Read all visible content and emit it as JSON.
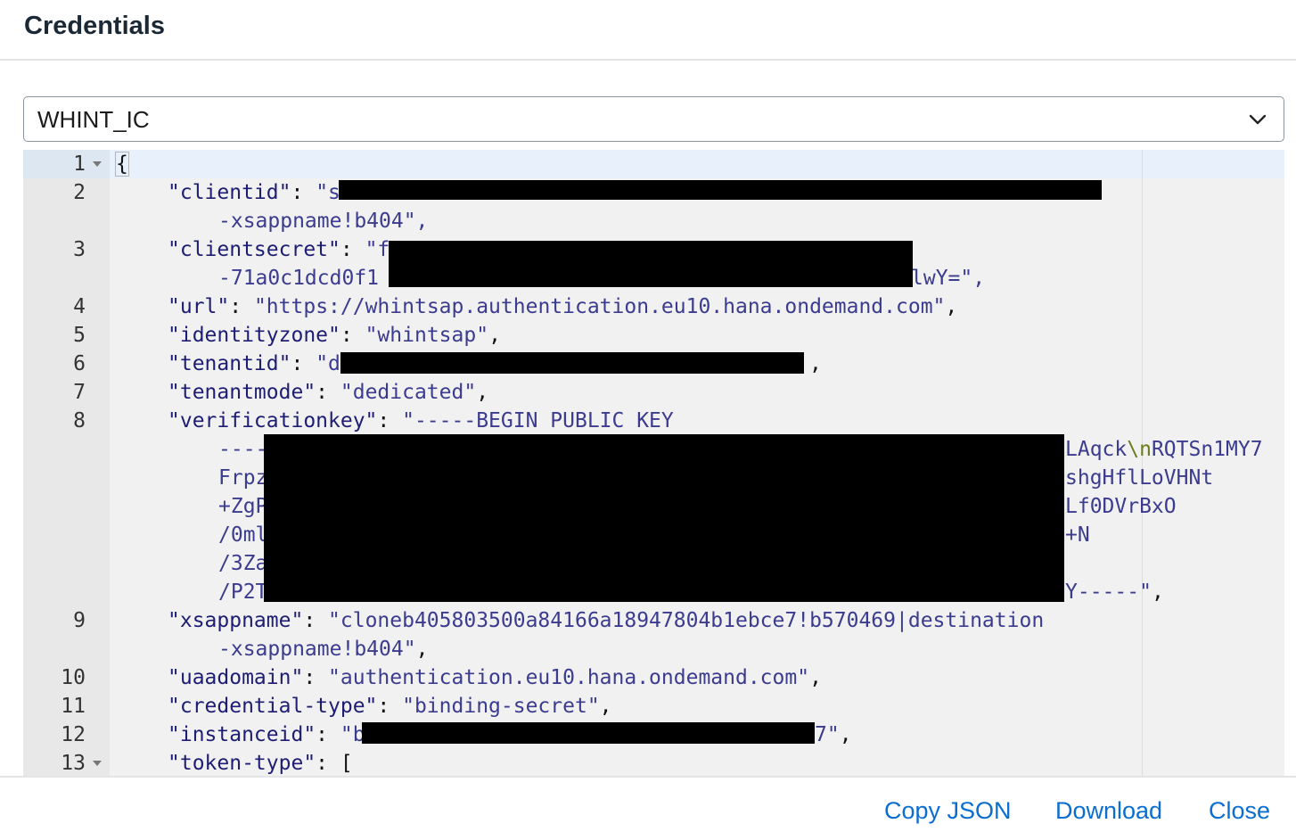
{
  "dialog": {
    "title": "Credentials"
  },
  "select": {
    "value": "WHINT_IC",
    "icon": "chevron-down-icon"
  },
  "editor": {
    "line_numbers": [
      "1",
      "2",
      "3",
      "4",
      "5",
      "6",
      "7",
      "8",
      "9",
      "10",
      "11",
      "12",
      "13"
    ],
    "lines": {
      "l1": "{",
      "l2_key": "\"clientid\"",
      "l2_colon": ": ",
      "l2_val": "\"s",
      "l2b": "-xsappname!b404\",",
      "l3_key": "\"clientsecret\"",
      "l3_colon": ": ",
      "l3_val": "\"f",
      "l3b": "-71a0c1dcd0f1",
      "l3b_end": "lwY=\",",
      "l4_key": "\"url\"",
      "l4_colon": ": ",
      "l4_val": "\"https://whintsap.authentication.eu10.hana.ondemand.com\"",
      "l4_end": ",",
      "l5_key": "\"identityzone\"",
      "l5_colon": ": ",
      "l5_val": "\"whintsap\"",
      "l5_end": ",",
      "l6_key": "\"tenantid\"",
      "l6_colon": ": ",
      "l6_val": "\"d",
      "l6_end": ",",
      "l7_key": "\"tenantmode\"",
      "l7_colon": ": ",
      "l7_val": "\"dedicated\"",
      "l7_end": ",",
      "l8_key": "\"verificationkey\"",
      "l8_colon": ": ",
      "l8_val": "\"-----BEGIN PUBLIC KEY",
      "l8b_start": "----",
      "l8b_end1": "LAqck",
      "l8b_esc": "\\n",
      "l8b_end2": "RQTSn1MY7",
      "l8c_start": "Frpz",
      "l8c_end": "shgHflLoVHNt",
      "l8d_start": "+ZgP",
      "l8d_end": "Lf0DVrBxO",
      "l8e_start": "/0ml",
      "l8e_end": "+N",
      "l8f_start": "/3Za",
      "l8g_start": "/P2T",
      "l8g_end": "Y-----\"",
      "l8g_comma": ",",
      "l9_key": "\"xsappname\"",
      "l9_colon": ": ",
      "l9_val": "\"cloneb405803500a84166a18947804b1ebce7!b570469|destination",
      "l9b": "-xsappname!b404\"",
      "l9b_end": ",",
      "l10_key": "\"uaadomain\"",
      "l10_colon": ": ",
      "l10_val": "\"authentication.eu10.hana.ondemand.com\"",
      "l10_end": ",",
      "l11_key": "\"credential-type\"",
      "l11_colon": ": ",
      "l11_val": "\"binding-secret\"",
      "l11_end": ",",
      "l12_key": "\"instanceid\"",
      "l12_colon": ": ",
      "l12_val": "\"b",
      "l12_tail": "7\"",
      "l12_end": ",",
      "l13_key": "\"token-type\"",
      "l13_colon": ": ",
      "l13_val": "["
    }
  },
  "footer": {
    "copy_label": "Copy JSON",
    "download_label": "Download",
    "close_label": "Close"
  }
}
